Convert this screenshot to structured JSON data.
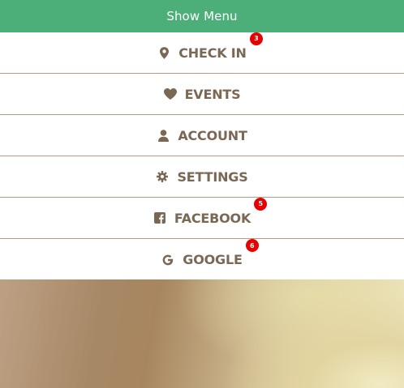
{
  "header": {
    "label": "Show Menu"
  },
  "menu": {
    "items": [
      {
        "label": "CHECK IN",
        "icon": "map-marker-icon",
        "badge": "3"
      },
      {
        "label": "EVENTS",
        "icon": "heart-icon",
        "badge": null
      },
      {
        "label": "ACCOUNT",
        "icon": "user-icon",
        "badge": null
      },
      {
        "label": "SETTINGS",
        "icon": "gear-icon",
        "badge": null
      },
      {
        "label": "FACEBOOK",
        "icon": "facebook-icon",
        "badge": "5"
      },
      {
        "label": "GOOGLE",
        "icon": "google-icon",
        "badge": "6"
      }
    ]
  },
  "colors": {
    "header_bg": "#4caf7a",
    "menu_text": "#7a6754",
    "divider": "#b59b82",
    "badge_bg": "#e80000"
  }
}
